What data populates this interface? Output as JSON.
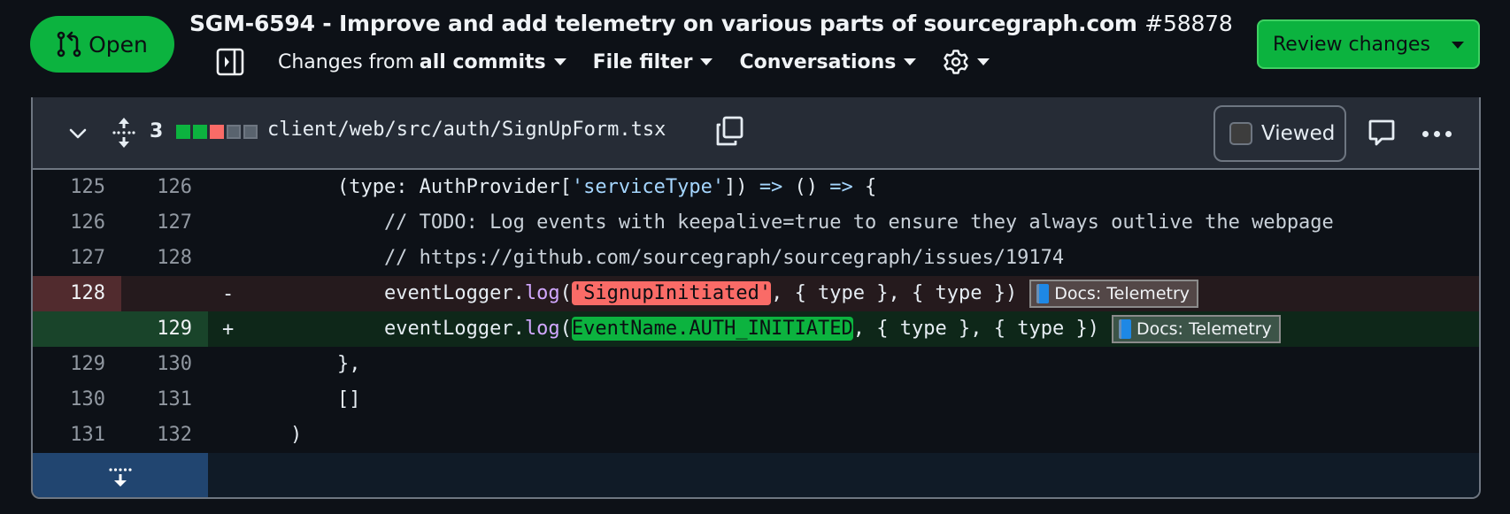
{
  "header": {
    "status_label": "Open",
    "status_color": "#0cb33f",
    "title": "SGM-6594 - Improve and add telemetry on various parts of sourcegraph.com",
    "pr_number": "#58878",
    "changes_from_prefix": "Changes from",
    "changes_from_value": "all commits",
    "file_filter_label": "File filter",
    "conversations_label": "Conversations",
    "review_button_label": "Review changes"
  },
  "file": {
    "change_count": "3",
    "diffstat": [
      "add",
      "add",
      "del",
      "neutral",
      "neutral"
    ],
    "path": "client/web/src/auth/SignUpForm.tsx",
    "viewed_label": "Viewed",
    "viewed_checked": false
  },
  "diff": {
    "lines": [
      {
        "old": "125",
        "new": "126",
        "marker": "",
        "type": "context"
      },
      {
        "old": "126",
        "new": "127",
        "marker": "",
        "type": "context",
        "text": "            // TODO: Log events with keepalive=true to ensure they always outlive the webpage"
      },
      {
        "old": "127",
        "new": "128",
        "marker": "",
        "type": "context",
        "text": "            // https://github.com/sourcegraph/sourcegraph/issues/19174"
      },
      {
        "old": "128",
        "new": "",
        "marker": "-",
        "type": "del"
      },
      {
        "old": "",
        "new": "129",
        "marker": "+",
        "type": "add"
      },
      {
        "old": "129",
        "new": "130",
        "marker": "",
        "type": "context",
        "text": "        },"
      },
      {
        "old": "130",
        "new": "131",
        "marker": "",
        "type": "context",
        "text": "        []"
      },
      {
        "old": "131",
        "new": "132",
        "marker": "",
        "type": "context",
        "text": "    )"
      }
    ],
    "line1": {
      "indent": "        ",
      "pre": "(type: AuthProvider[",
      "str": "'serviceType'",
      "mid": "]) ",
      "arrow1": "=>",
      "sp": " () ",
      "arrow2": "=>",
      "post": " {"
    },
    "del_line": {
      "indent": "            ",
      "obj": "eventLogger.",
      "fn": "log",
      "open": "(",
      "highlight": "'SignupInitiated'",
      "rest": ", { type }, { type })"
    },
    "add_line": {
      "indent": "            ",
      "obj": "eventLogger.",
      "fn": "log",
      "open": "(",
      "highlight": "EventName.AUTH_INITIATED",
      "rest": ", { type }, { type })"
    },
    "docs_tag_label": "Docs: Telemetry"
  }
}
